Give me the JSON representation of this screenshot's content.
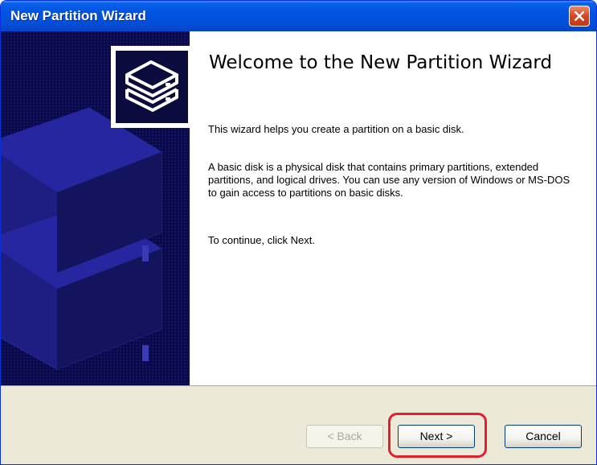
{
  "window": {
    "title": "New Partition Wizard"
  },
  "content": {
    "heading": "Welcome to the New Partition Wizard",
    "intro": "This wizard helps you create a partition on a basic disk.",
    "description": "A basic disk is a physical disk that contains primary partitions, extended partitions, and logical drives. You can use any version of Windows or MS-DOS to gain access to partitions on basic disks.",
    "instruction": "To continue, click Next."
  },
  "buttons": {
    "back": "< Back",
    "next": "Next >",
    "cancel": "Cancel"
  },
  "icons": {
    "close": "close-icon",
    "wizard": "stacked-disks-icon"
  },
  "colors": {
    "titlebar": "#0054e3",
    "side_panel": "#0a0a4a",
    "highlight": "#e0202a",
    "footer": "#ece9d8"
  }
}
